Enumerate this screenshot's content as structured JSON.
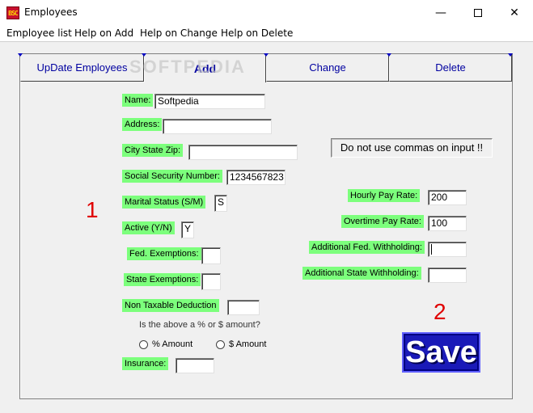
{
  "window": {
    "title": "Employees",
    "icon": "app-icon-bsc"
  },
  "menu": [
    {
      "label": "Employee list"
    },
    {
      "label": "Help on Add"
    },
    {
      "label": "Help on Change"
    },
    {
      "label": "Help on Delete"
    }
  ],
  "tabs": [
    {
      "label": "UpDate Employees",
      "active": false
    },
    {
      "label": "Add",
      "active": true
    },
    {
      "label": "Change",
      "active": false
    },
    {
      "label": "Delete",
      "active": false
    }
  ],
  "form": {
    "name": {
      "label": "Name:",
      "value": "Softpedia"
    },
    "address": {
      "label": "Address:",
      "value": ""
    },
    "city": {
      "label": "City State Zip:",
      "value": ""
    },
    "ssn": {
      "label": "Social Security Number:",
      "value": "1234567823"
    },
    "marital": {
      "label": "Marital Status  (S/M)",
      "value": "S"
    },
    "active": {
      "label": "Active (Y/N)",
      "value": "Y"
    },
    "fed_ex": {
      "label": "Fed. Exemptions:",
      "value": ""
    },
    "state_ex": {
      "label": "State Exemptions:",
      "value": ""
    },
    "non_tax": {
      "label": "Non Taxable Deduction",
      "value": ""
    },
    "question": "Is the above a % or $ amount?",
    "radio_pct": "% Amount",
    "radio_dol": "$ Amount",
    "insurance": {
      "label": "Insurance:",
      "value": ""
    },
    "hourly": {
      "label": "Hourly Pay Rate:",
      "value": "200"
    },
    "overtime": {
      "label": "Overtime Pay Rate:",
      "value": "100"
    },
    "add_fed": {
      "label": "Additional Fed. Withholding:",
      "value": ""
    },
    "add_state": {
      "label": "Additional State Withholding:",
      "value": ""
    }
  },
  "note": "Do not use commas on input !!",
  "annotations": {
    "one": "1",
    "two": "2"
  },
  "save_label": "Save",
  "watermark": "SOFTPEDIA",
  "colors": {
    "label_bg": "#7cff7c",
    "tab_text": "#0000a0",
    "save_bg": "#1a1ab8",
    "annotation": "#e00000"
  }
}
